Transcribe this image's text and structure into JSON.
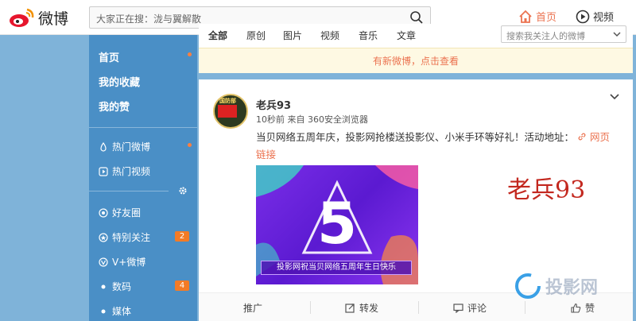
{
  "header": {
    "logo_text": "微博",
    "search_placeholder": "大家正在搜：泷与翼解散",
    "nav_home": "首页",
    "nav_video": "视频"
  },
  "sidebar": {
    "items": [
      {
        "label": "首页"
      },
      {
        "label": "我的收藏"
      },
      {
        "label": "我的赞"
      },
      {
        "label": "热门微博"
      },
      {
        "label": "热门视频"
      },
      {
        "label": "好友圈"
      },
      {
        "label": "特别关注",
        "badge": "2"
      },
      {
        "label": "V+微博"
      },
      {
        "label": "数码",
        "badge": "4"
      },
      {
        "label": "媒体"
      }
    ]
  },
  "tabs": {
    "items": [
      "全部",
      "原创",
      "图片",
      "视频",
      "音乐",
      "文章"
    ],
    "search_placeholder": "搜索我关注人的微博",
    "notice": "有新微博，点击查看"
  },
  "post": {
    "author": "老兵93",
    "meta": "10秒前 来自 360安全浏览器",
    "text": "当贝网络五周年庆，投影网抢楼送投影仪、小米手环等好礼！活动地址：",
    "link_text": "网页链接",
    "banner_text": "投影网祝当贝网络五周年生日快乐",
    "avatar_text": "国防部",
    "watermark": "老兵93",
    "actions": {
      "promote": "推广",
      "repost": "转发",
      "comment": "评论",
      "like": "赞"
    }
  },
  "site_watermark": "投影网",
  "colors": {
    "accent": "#eb7350",
    "sidebar": "#4a8fc6",
    "background": "#7fb3d9"
  }
}
